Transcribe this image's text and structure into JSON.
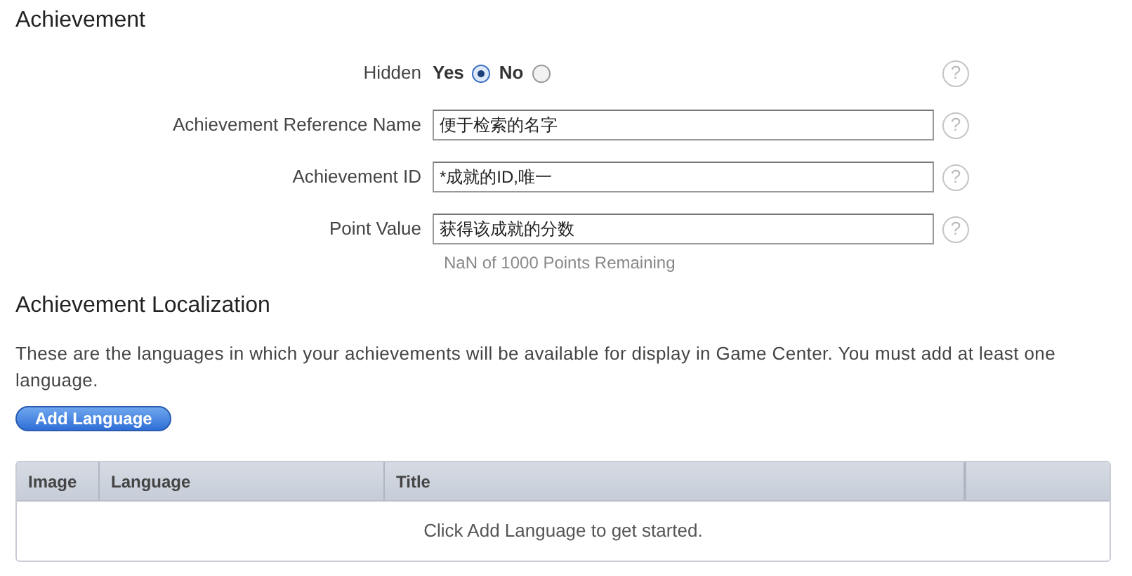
{
  "section_title": "Achievement",
  "hidden": {
    "label": "Hidden",
    "options": [
      {
        "label": "Yes",
        "selected": true
      },
      {
        "label": "No",
        "selected": false
      }
    ]
  },
  "fields": [
    {
      "label": "Achievement Reference Name",
      "value": "便于检索的名字"
    },
    {
      "label": "Achievement ID",
      "value": "*成就的ID,唯一"
    },
    {
      "label": "Point Value",
      "value": "获得该成就的分数",
      "note": "NaN of 1000 Points Remaining"
    }
  ],
  "help_mark": "?",
  "localization": {
    "title": "Achievement Localization",
    "description": "These are the languages in which your achievements will be available for display in Game Center. You must add at least one language.",
    "button": "Add Language",
    "table": {
      "columns": [
        "Image",
        "Language",
        "Title"
      ],
      "empty_message": "Click Add Language to get started."
    }
  }
}
